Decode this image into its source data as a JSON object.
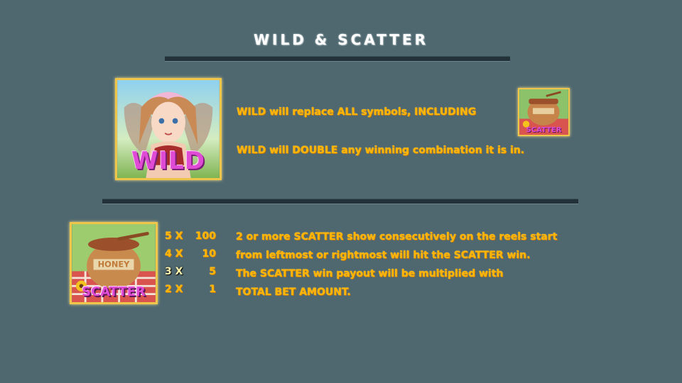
{
  "header": {
    "title": "WILD & SCATTER"
  },
  "wild_section": {
    "symbol_text": "WILD",
    "line1": "WILD will replace ALL symbols, INCLUDING",
    "line2": "WILD will DOUBLE any winning combination it is in."
  },
  "scatter_section": {
    "symbol_text": "SCATTER",
    "jar_text": "HONEY",
    "paytable": [
      {
        "mult": "5 X",
        "amount": "100",
        "active": false
      },
      {
        "mult": "4 X",
        "amount": "10",
        "active": false
      },
      {
        "mult": "3 X",
        "amount": "5",
        "active": true
      },
      {
        "mult": "2 X",
        "amount": "1",
        "active": false
      }
    ],
    "description": [
      "2 or more SCATTER show consecutively on the reels start",
      "from leftmost or rightmost will hit the SCATTER win.",
      "The SCATTER win payout will be multiplied with",
      "TOTAL BET AMOUNT."
    ]
  },
  "colors": {
    "background": "#4f6870",
    "gold_text": "#ffb400",
    "frame": "#f0c64a",
    "wild_text": "#e04bd6"
  }
}
